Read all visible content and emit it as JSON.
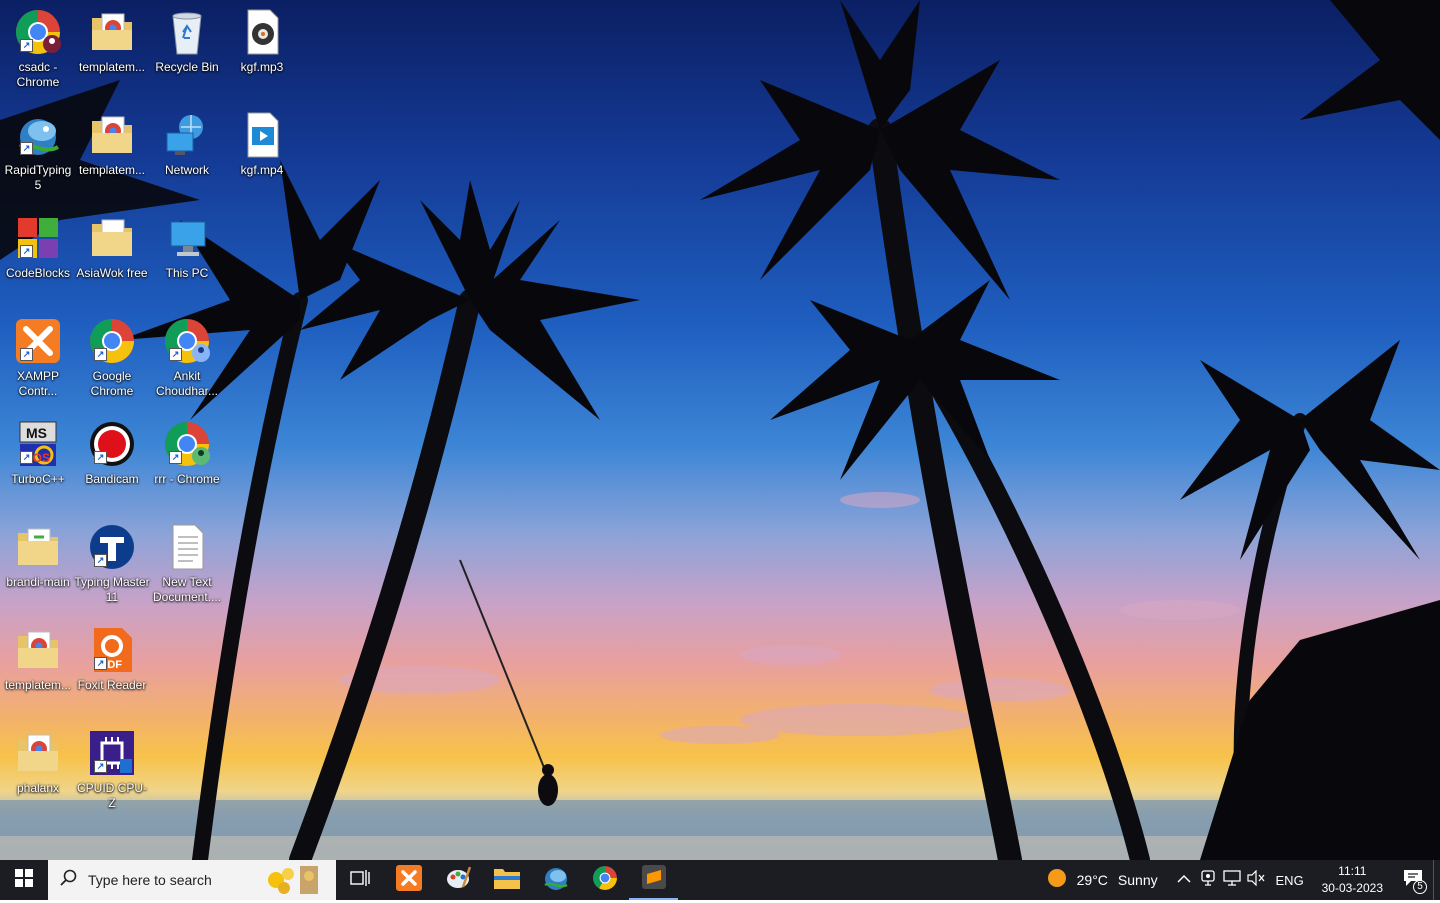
{
  "desktop": {
    "icons": [
      {
        "id": "csadc-chrome",
        "label": "csadc - Chrome",
        "icon": "chrome-profile-icon"
      },
      {
        "id": "templatem-1",
        "label": "templatem...",
        "icon": "folder-chrome-icon"
      },
      {
        "id": "recycle-bin",
        "label": "Recycle Bin",
        "icon": "recycle-bin-icon"
      },
      {
        "id": "kgf-mp3",
        "label": "kgf.mp3",
        "icon": "audio-file-icon"
      },
      {
        "id": "rapidtyping",
        "label": "RapidTyping 5",
        "icon": "rapidtyping-icon"
      },
      {
        "id": "templatem-2",
        "label": "templatem...",
        "icon": "folder-chrome-icon"
      },
      {
        "id": "network",
        "label": "Network",
        "icon": "network-icon"
      },
      {
        "id": "kgf-mp4",
        "label": "kgf.mp4",
        "icon": "video-file-icon"
      },
      {
        "id": "codeblocks",
        "label": "CodeBlocks",
        "icon": "codeblocks-icon"
      },
      {
        "id": "asiawok",
        "label": "AsiaWok free",
        "icon": "folder-icon"
      },
      {
        "id": "this-pc",
        "label": "This PC",
        "icon": "this-pc-icon"
      },
      {
        "id": "xampp",
        "label": "XAMPP Contr...",
        "icon": "xampp-icon"
      },
      {
        "id": "google-chrome",
        "label": "Google Chrome",
        "icon": "chrome-icon"
      },
      {
        "id": "ankit-chrome",
        "label": "Ankit Choudhar...",
        "icon": "chrome-profile-icon"
      },
      {
        "id": "turboc",
        "label": "TurboC++",
        "icon": "turboc-icon"
      },
      {
        "id": "bandicam",
        "label": "Bandicam",
        "icon": "bandicam-icon"
      },
      {
        "id": "rrr-chrome",
        "label": "rrr - Chrome",
        "icon": "chrome-profile-icon"
      },
      {
        "id": "brandi-main",
        "label": "brandi-main",
        "icon": "folder-icon"
      },
      {
        "id": "typing-master",
        "label": "Typing Master 11",
        "icon": "typing-master-icon"
      },
      {
        "id": "new-text-doc",
        "label": "New Text Document....",
        "icon": "text-file-icon"
      },
      {
        "id": "templatem-3",
        "label": "templatem...",
        "icon": "folder-chrome-icon"
      },
      {
        "id": "foxit",
        "label": "Foxit Reader",
        "icon": "foxit-pdf-icon"
      },
      {
        "id": "phalanx",
        "label": "phalanx",
        "icon": "folder-chrome-icon"
      },
      {
        "id": "cpuz",
        "label": "CPUID CPU-Z",
        "icon": "cpuz-icon"
      }
    ]
  },
  "taskbar": {
    "search_placeholder": "Type here to search",
    "pinned": [
      "xampp-icon",
      "paint-icon",
      "file-explorer-icon",
      "rapidtyping-icon",
      "chrome-icon",
      "sublime-text-icon"
    ],
    "weather": {
      "temp": "29°C",
      "condition": "Sunny"
    },
    "language": "ENG",
    "time": "11:11",
    "date": "30-03-2023",
    "notifications": "5"
  }
}
